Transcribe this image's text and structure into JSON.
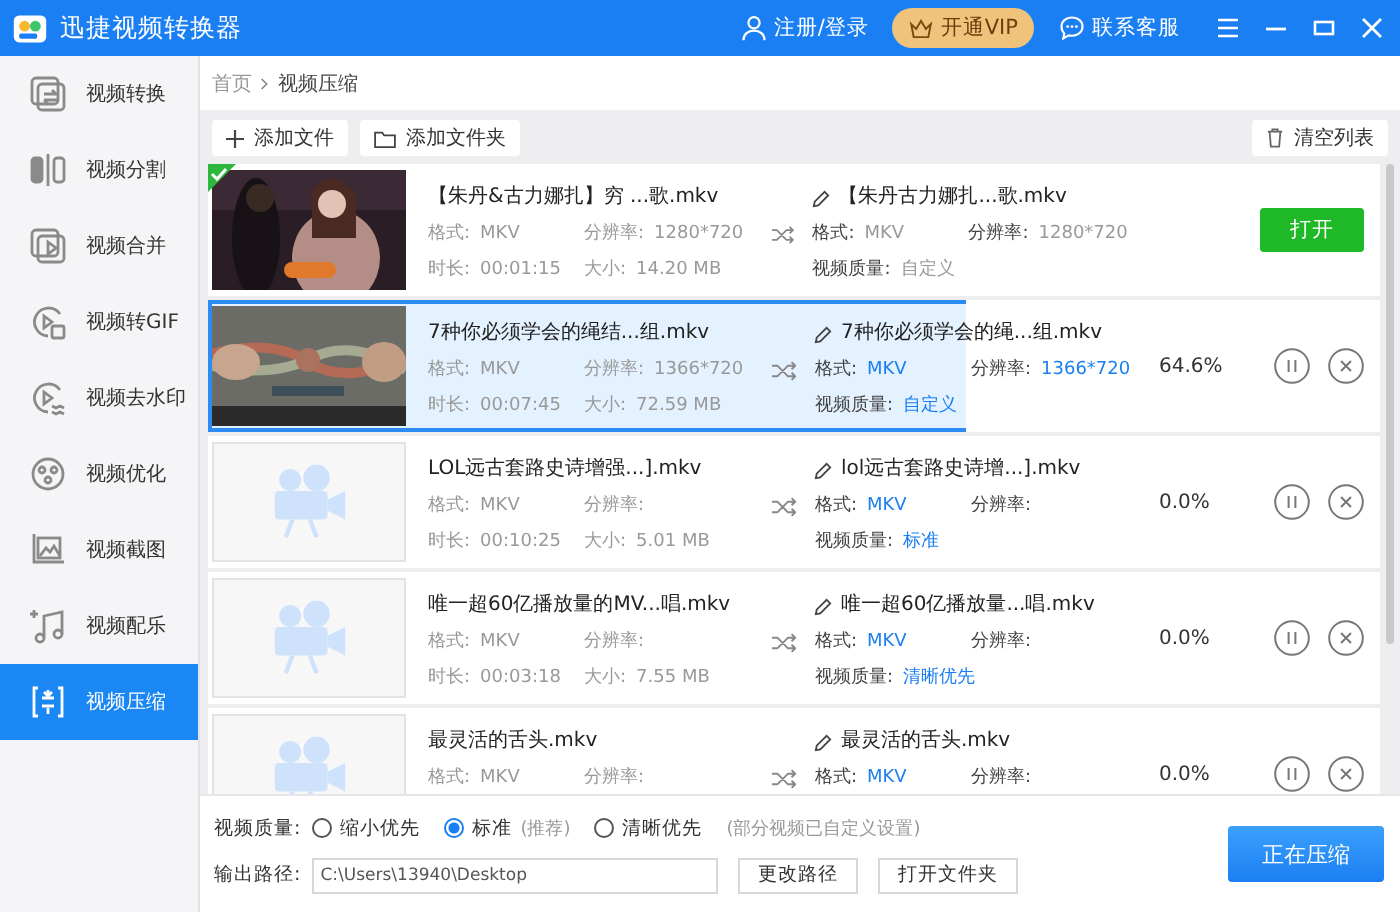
{
  "window": {
    "title": "迅捷视频转换器",
    "login": "注册/登录",
    "vip": "开通VIP",
    "support": "联系客服"
  },
  "sidebar": {
    "items": [
      {
        "label": "视频转换",
        "selected": false
      },
      {
        "label": "视频分割",
        "selected": false
      },
      {
        "label": "视频合并",
        "selected": false
      },
      {
        "label": "视频转GIF",
        "selected": false
      },
      {
        "label": "视频去水印",
        "selected": false
      },
      {
        "label": "视频优化",
        "selected": false
      },
      {
        "label": "视频截图",
        "selected": false
      },
      {
        "label": "视频配乐",
        "selected": false
      },
      {
        "label": "视频压缩",
        "selected": true
      }
    ]
  },
  "breadcrumb": [
    "首页",
    "视频压缩"
  ],
  "toolbar": {
    "add_file": "添加文件",
    "add_folder": "添加文件夹",
    "clear": "清空列表"
  },
  "rows": [
    {
      "kind": "done",
      "source": {
        "name": "【朱丹&古力娜扎】穷 ...歌.mkv",
        "lines": [
          [
            {
              "label": "格式:",
              "value": "MKV"
            },
            {
              "label": "分辨率:",
              "value": "1280*720"
            }
          ],
          [
            {
              "label": "时长:",
              "value": "00:01:15"
            },
            {
              "label": "大小:",
              "value": "14.20 MB"
            }
          ]
        ]
      },
      "output": {
        "name": "【朱丹古力娜扎...歌.mkv",
        "lines": [
          [
            {
              "label": "格式:",
              "value": "MKV"
            },
            {
              "label": "分辨率:",
              "value": "1280*720"
            }
          ],
          [
            {
              "label": "视频质量:",
              "value": "自定义"
            }
          ]
        ]
      },
      "open_button": "打开"
    },
    {
      "kind": "compressing",
      "level": 0.646,
      "progress": "64.6%",
      "source": {
        "name": "7种你必须学会的绳结...组.mkv",
        "lines": [
          [
            {
              "label": "格式:",
              "value": "MKV"
            },
            {
              "label": "分辨率:",
              "value": "1366*720"
            }
          ],
          [
            {
              "label": "时长:",
              "value": "00:07:45"
            },
            {
              "label": "大小:",
              "value": "72.59 MB"
            }
          ]
        ]
      },
      "output": {
        "name": "7种你必须学会的绳...组.mkv",
        "lines": [
          [
            {
              "label": "格式:",
              "value": "MKV"
            },
            {
              "label": "分辨率:",
              "value": "1366*720"
            }
          ],
          [
            {
              "label": "视频质量:",
              "value": "自定义"
            }
          ]
        ]
      }
    },
    {
      "kind": "waiting",
      "thumbnail": {
        "kind": "placeholder"
      },
      "progress": "0.0%",
      "source": {
        "name": "LOL远古套路史诗增强...].mkv",
        "lines": [
          [
            {
              "label": "格式:",
              "value": "MKV"
            },
            {
              "label": "分辨率:"
            }
          ],
          [
            {
              "label": "时长:",
              "value": "00:10:25"
            },
            {
              "label": "大小:",
              "value": "5.01 MB"
            }
          ]
        ]
      },
      "output": {
        "name": "lol远古套路史诗增...].mkv",
        "lines": [
          [
            {
              "label": "格式:",
              "value": "MKV"
            },
            {
              "label": "分辨率:"
            }
          ],
          [
            {
              "label": "视频质量:",
              "value": "标准"
            }
          ]
        ]
      }
    },
    {
      "kind": "waiting",
      "thumbnail": {
        "kind": "placeholder"
      },
      "progress": "0.0%",
      "source": {
        "name": "唯一超60亿播放量的MV...唱.mkv",
        "lines": [
          [
            {
              "label": "格式:",
              "value": "MKV"
            },
            {
              "label": "分辨率:"
            }
          ],
          [
            {
              "label": "时长:",
              "value": "00:03:18"
            },
            {
              "label": "大小:",
              "value": "7.55 MB"
            }
          ]
        ]
      },
      "output": {
        "name": "唯一超60亿播放量...唱.mkv",
        "lines": [
          [
            {
              "label": "格式:",
              "value": "MKV"
            },
            {
              "label": "分辨率:"
            }
          ],
          [
            {
              "label": "视频质量:",
              "value": "清晰优先"
            }
          ]
        ]
      }
    },
    {
      "kind": "waiting",
      "thumbnail": {
        "kind": "placeholder"
      },
      "progress": "0.0%",
      "source": {
        "name": "最灵活的舌头.mkv",
        "lines": [
          [
            {
              "label": "格式:",
              "value": "MKV"
            },
            {
              "label": "分辨率:"
            }
          ]
        ]
      },
      "output": {
        "name": "最灵活的舌头.mkv",
        "lines": [
          [
            {
              "label": "格式:",
              "value": "MKV"
            },
            {
              "label": "分辨率:"
            }
          ]
        ]
      }
    }
  ],
  "settings": {
    "quality_label": "视频质量:",
    "options": [
      {
        "label": "缩小优先",
        "selected": false
      },
      {
        "label": "标准",
        "hint": "(推荐)",
        "selected": true
      },
      {
        "label": "清晰优先",
        "selected": false
      }
    ],
    "note": "(部分视频已自定义设置)",
    "path_label": "输出路径:",
    "path": "C:\\Users\\13940\\Desktop",
    "change_path": "更改路径",
    "open_folder": "打开文件夹",
    "start": "正在压缩"
  }
}
